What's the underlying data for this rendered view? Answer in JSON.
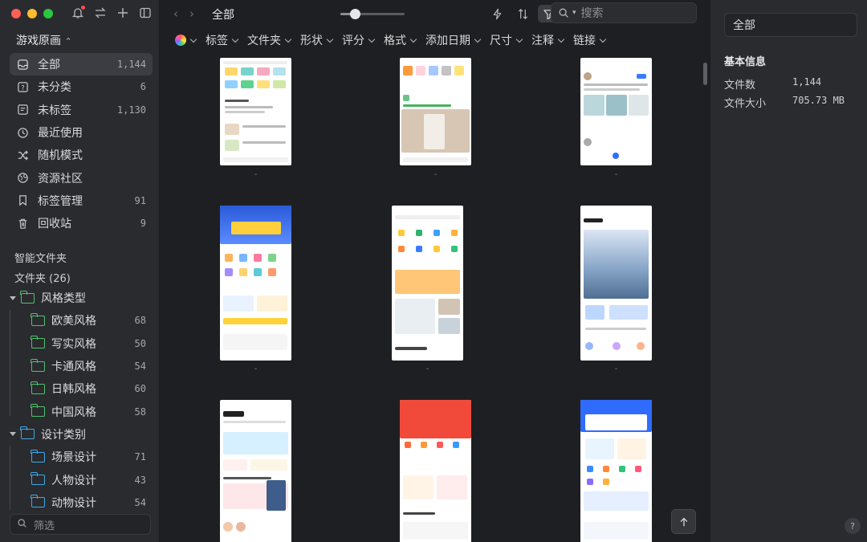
{
  "sidebar": {
    "library_name": "游戏原画",
    "nav": [
      {
        "label": "全部",
        "count": "1,144",
        "icon": "inbox-icon"
      },
      {
        "label": "未分类",
        "count": "6",
        "icon": "question-box-icon"
      },
      {
        "label": "未标签",
        "count": "1,130",
        "icon": "tag-icon"
      },
      {
        "label": "最近使用",
        "count": "",
        "icon": "clock-icon"
      },
      {
        "label": "随机模式",
        "count": "",
        "icon": "shuffle-icon"
      },
      {
        "label": "资源社区",
        "count": "",
        "icon": "globe-icon"
      },
      {
        "label": "标签管理",
        "count": "91",
        "icon": "bookmark-icon"
      },
      {
        "label": "回收站",
        "count": "9",
        "icon": "trash-icon"
      }
    ],
    "smart_folders_label": "智能文件夹",
    "folders_label": "文件夹 (26)",
    "tree": [
      {
        "label": "风格类型",
        "count": "",
        "level": 0,
        "color": "#4fc36b"
      },
      {
        "label": "欧美风格",
        "count": "68",
        "level": 1,
        "color": "#4fc36b"
      },
      {
        "label": "写实风格",
        "count": "50",
        "level": 1,
        "color": "#4fc36b"
      },
      {
        "label": "卡通风格",
        "count": "54",
        "level": 1,
        "color": "#4fc36b"
      },
      {
        "label": "日韩风格",
        "count": "60",
        "level": 1,
        "color": "#4fc36b"
      },
      {
        "label": "中国风格",
        "count": "58",
        "level": 1,
        "color": "#4fc36b"
      },
      {
        "label": "设计类别",
        "count": "",
        "level": 0,
        "color": "#3fa9e8"
      },
      {
        "label": "场景设计",
        "count": "71",
        "level": 1,
        "color": "#3fa9e8"
      },
      {
        "label": "人物设计",
        "count": "43",
        "level": 1,
        "color": "#3fa9e8"
      },
      {
        "label": "动物设计",
        "count": "54",
        "level": 1,
        "color": "#3fa9e8"
      }
    ],
    "filter_placeholder": "筛选"
  },
  "main": {
    "title": "全部",
    "zoom_level": 0.22,
    "search_placeholder": "搜索",
    "filters": [
      "标签",
      "文件夹",
      "形状",
      "评分",
      "格式",
      "添加日期",
      "尺寸",
      "注释",
      "链接"
    ],
    "captions": [
      "-",
      "-",
      "-",
      "-",
      "-",
      "-"
    ]
  },
  "inspector": {
    "name": "全部",
    "section_title": "基本信息",
    "rows": [
      {
        "label": "文件数",
        "value": "1,144"
      },
      {
        "label": "文件大小",
        "value": "705.73 MB"
      }
    ],
    "help": "?"
  },
  "colors": {
    "accent_green": "#4fc36b",
    "accent_blue": "#3fa9e8",
    "close": "#fe5f57",
    "minimize": "#febc2e",
    "maximize": "#28c840"
  }
}
